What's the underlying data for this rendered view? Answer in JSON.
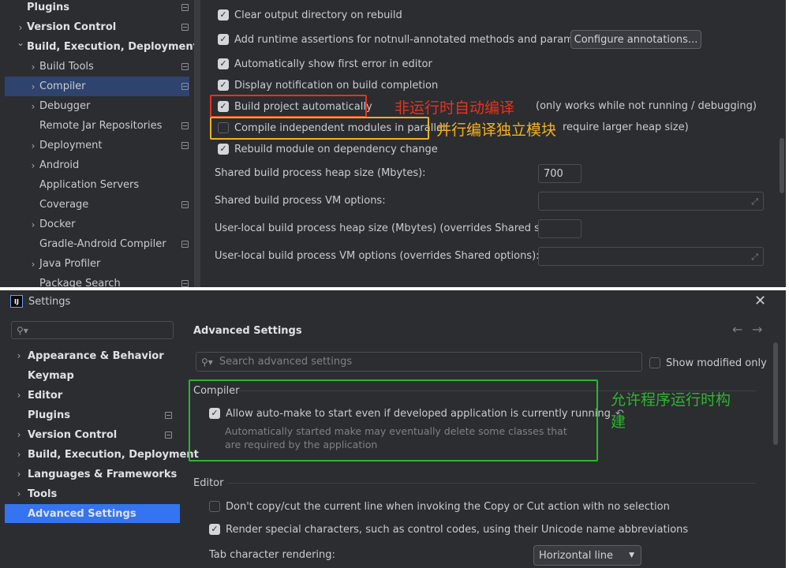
{
  "top": {
    "tree": [
      {
        "label": "Plugins",
        "bold": true,
        "chevron": false,
        "pin": true,
        "level": 0
      },
      {
        "label": "Version Control",
        "bold": true,
        "chevron": "right",
        "pin": true,
        "level": 0
      },
      {
        "label": "Build, Execution, Deployment",
        "bold": true,
        "chevron": "down",
        "pin": false,
        "level": 0
      },
      {
        "label": "Build Tools",
        "bold": false,
        "chevron": "right",
        "pin": true,
        "level": 1
      },
      {
        "label": "Compiler",
        "bold": false,
        "chevron": "right",
        "pin": true,
        "level": 1,
        "selected": true
      },
      {
        "label": "Debugger",
        "bold": false,
        "chevron": "right",
        "pin": false,
        "level": 1
      },
      {
        "label": "Remote Jar Repositories",
        "bold": false,
        "chevron": false,
        "pin": true,
        "level": 1
      },
      {
        "label": "Deployment",
        "bold": false,
        "chevron": "right",
        "pin": true,
        "level": 1
      },
      {
        "label": "Android",
        "bold": false,
        "chevron": "right",
        "pin": false,
        "level": 1
      },
      {
        "label": "Application Servers",
        "bold": false,
        "chevron": false,
        "pin": false,
        "level": 1
      },
      {
        "label": "Coverage",
        "bold": false,
        "chevron": false,
        "pin": true,
        "level": 1
      },
      {
        "label": "Docker",
        "bold": false,
        "chevron": "right",
        "pin": false,
        "level": 1
      },
      {
        "label": "Gradle-Android Compiler",
        "bold": false,
        "chevron": false,
        "pin": true,
        "level": 1
      },
      {
        "label": "Java Profiler",
        "bold": false,
        "chevron": "right",
        "pin": false,
        "level": 1
      },
      {
        "label": "Package Search",
        "bold": false,
        "chevron": false,
        "pin": true,
        "level": 1
      }
    ],
    "options": {
      "clear_output": {
        "label": "Clear output directory on rebuild",
        "checked": true
      },
      "runtime_assertions": {
        "label": "Add runtime assertions for notnull-annotated methods and parameters",
        "checked": true
      },
      "configure_button": "Configure annotations...",
      "show_first_error": {
        "label": "Automatically show first error in editor",
        "checked": true
      },
      "display_notification": {
        "label": "Display notification on build completion",
        "checked": true
      },
      "build_auto": {
        "label": "Build project automatically",
        "checked": true,
        "hint": "(only works while not running / debugging)"
      },
      "compile_parallel": {
        "label": "Compile independent modules in parallel",
        "checked": false,
        "hint": "require larger heap size)"
      },
      "rebuild_module": {
        "label": "Rebuild module on dependency change",
        "checked": true
      }
    },
    "fields": {
      "heap_label": "Shared build process heap size (Mbytes):",
      "heap_value": "700",
      "vm_label": "Shared build process VM options:",
      "user_heap_label": "User-local build process heap size (Mbytes) (overrides Shared size):",
      "user_vm_label": "User-local build process VM options (overrides Shared options):"
    },
    "annotations": {
      "build_auto_cn": "非运行时自动编译",
      "parallel_cn": "并行编译独立模块"
    }
  },
  "bottom": {
    "window_title": "Settings",
    "app_icon_text": "IJ",
    "search_placeholder": "",
    "tree": [
      {
        "label": "Appearance & Behavior",
        "chevron": "right",
        "pin": false
      },
      {
        "label": "Keymap",
        "chevron": false,
        "pin": false
      },
      {
        "label": "Editor",
        "chevron": "right",
        "pin": false
      },
      {
        "label": "Plugins",
        "chevron": false,
        "pin": true
      },
      {
        "label": "Version Control",
        "chevron": "right",
        "pin": true
      },
      {
        "label": "Build, Execution, Deployment",
        "chevron": "right",
        "pin": false
      },
      {
        "label": "Languages & Frameworks",
        "chevron": "right",
        "pin": false
      },
      {
        "label": "Tools",
        "chevron": "right",
        "pin": false
      },
      {
        "label": "Advanced Settings",
        "chevron": false,
        "pin": false,
        "selected": true
      }
    ],
    "page_title": "Advanced Settings",
    "search_advanced_placeholder": "Search advanced settings",
    "show_modified": "Show modified only",
    "compiler_section": "Compiler",
    "allow_automake": "Allow auto-make to start even if developed application is currently running",
    "allow_automake_desc1": "Automatically started make may eventually delete some classes that",
    "allow_automake_desc2": "are required by the application",
    "allow_cn1": "允许程序运行时构",
    "allow_cn2": "建",
    "editor_section": "Editor",
    "dont_copy": "Don't copy/cut the current line when invoking the Copy or Cut action with no selection",
    "render_special": "Render special characters, such as control codes, using their Unicode name abbreviations",
    "tab_rendering_label": "Tab character rendering:",
    "tab_rendering_value": "Horizontal line"
  },
  "colors": {
    "red": "#e8321f",
    "orange": "#f5b21b",
    "green": "#2fb52f",
    "selected": "#2e436e",
    "adv_selected": "#3574f0"
  }
}
